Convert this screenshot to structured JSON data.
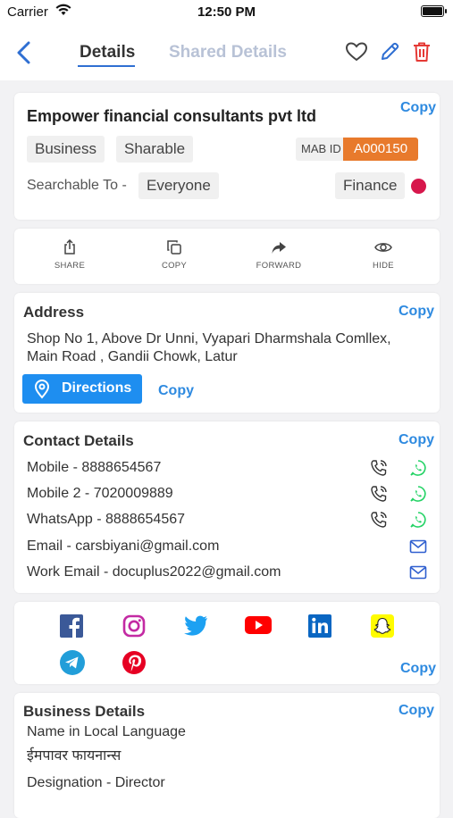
{
  "status": {
    "carrier": "Carrier",
    "time": "12:50 PM"
  },
  "nav": {
    "tab_details": "Details",
    "tab_shared": "Shared Details",
    "icons": [
      "back-chevron-icon",
      "heart-icon",
      "pencil-icon",
      "trash-icon"
    ]
  },
  "card": {
    "company_name": "Empower financial consultants pvt ltd",
    "copy": "Copy",
    "chip_type": "Business",
    "chip_share": "Sharable",
    "mab_label": "MAB ID",
    "mab_id": "A000150",
    "searchable_label": "Searchable To -",
    "searchable_value": "Everyone",
    "category": "Finance",
    "category_color": "#d7174c",
    "id_color": "#e87a2c"
  },
  "actions": [
    {
      "label": "SHARE",
      "icon": "share-icon"
    },
    {
      "label": "COPY",
      "icon": "copy-icon"
    },
    {
      "label": "FORWARD",
      "icon": "forward-icon"
    },
    {
      "label": "HIDE",
      "icon": "eye-icon"
    }
  ],
  "address": {
    "title": "Address",
    "copy": "Copy",
    "line1": "Shop No 1, Above Dr Unni, Vyapari Dharmshala Comllex,",
    "line2": "Main Road , Gandii Chowk, Latur",
    "directions": "Directions",
    "copy2": "Copy"
  },
  "contact": {
    "title": "Contact Details",
    "copy": "Copy",
    "mobile": "Mobile  - 8888654567",
    "mobile2": "Mobile 2 - 7020009889",
    "whatsapp": "WhatsApp - 8888654567",
    "email": "Email - carsbiyani@gmail.com",
    "work_email": "Work Email - docuplus2022@gmail.com"
  },
  "social": {
    "icons": [
      "facebook-icon",
      "instagram-icon",
      "twitter-icon",
      "youtube-icon",
      "linkedin-icon",
      "snapchat-icon",
      "telegram-icon",
      "pinterest-icon"
    ],
    "copy": "Copy"
  },
  "business": {
    "title": "Business Details",
    "copy": "Copy",
    "local_label": "Name in Local Language",
    "local_value": "ईमपावर फायनान्स",
    "designation": "Designation - Director"
  },
  "colors": {
    "accent": "#2e8ae0",
    "delete": "#e53935",
    "whatsapp": "#25d366"
  }
}
